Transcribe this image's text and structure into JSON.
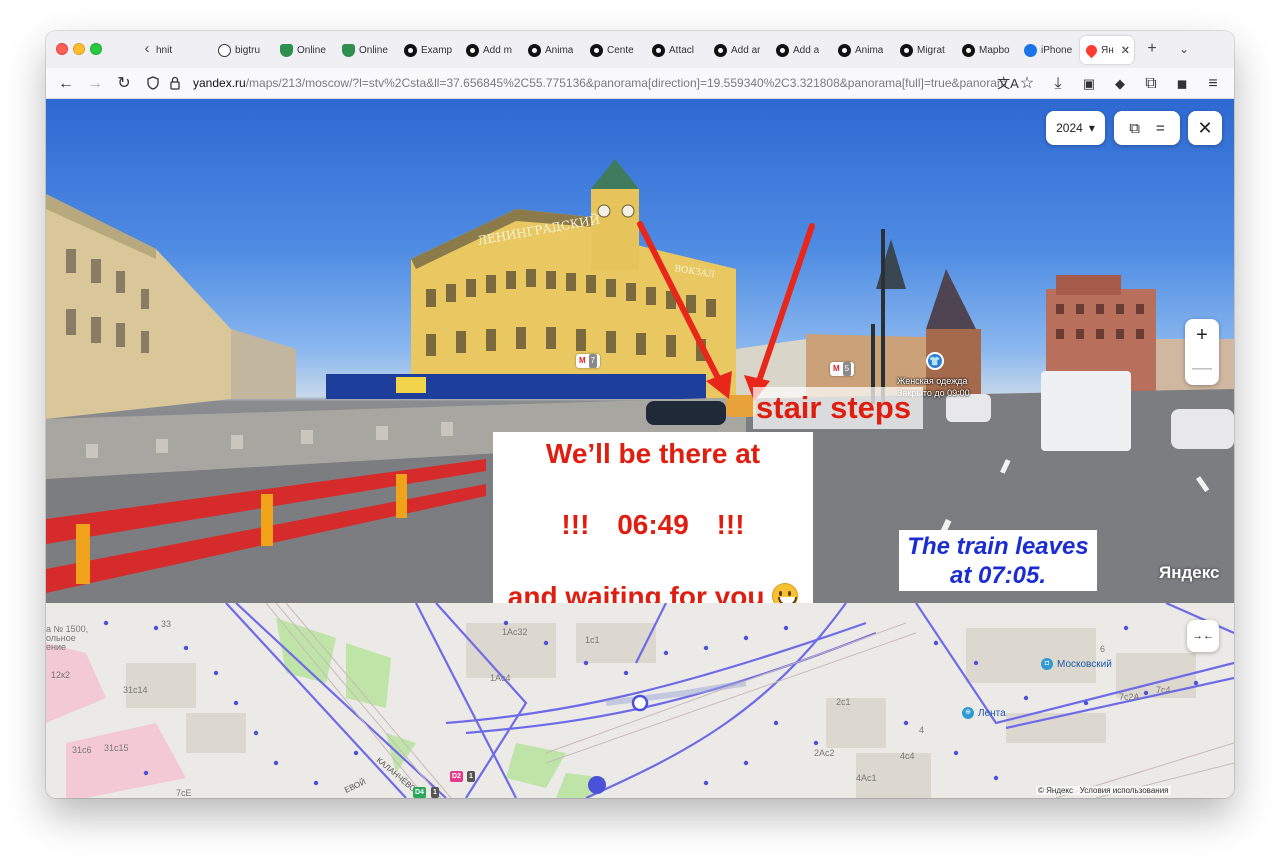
{
  "browser": {
    "tabs": [
      {
        "label": "hnit",
        "icon": "back-arrow-favicon"
      },
      {
        "label": "bigtru",
        "icon": "globe-favicon"
      },
      {
        "label": "Online",
        "icon": "shield-favicon"
      },
      {
        "label": "Online",
        "icon": "shield-favicon"
      },
      {
        "label": "Examp",
        "icon": "open-favicon"
      },
      {
        "label": "Add m",
        "icon": "open-favicon"
      },
      {
        "label": "Anima",
        "icon": "open-favicon"
      },
      {
        "label": "Cente",
        "icon": "open-favicon"
      },
      {
        "label": "Attacl",
        "icon": "open-favicon"
      },
      {
        "label": "Add ar",
        "icon": "open-favicon"
      },
      {
        "label": "Add a",
        "icon": "open-favicon"
      },
      {
        "label": "Anima",
        "icon": "open-favicon"
      },
      {
        "label": "Migrat",
        "icon": "open-favicon"
      },
      {
        "label": "Mapbo",
        "icon": "open-favicon"
      },
      {
        "label": "iPhone",
        "icon": "ip-favicon"
      }
    ],
    "active_tab": {
      "label": "Ян",
      "close": "✕"
    },
    "url_host": "yandex.ru",
    "url_path": "/maps/213/moscow/?l=stv%2Csta&ll=37.656845%2C55.775136&panorama[direction]=19.559340%2C3.321808&panorama[full]=true&panoram"
  },
  "panorama": {
    "year": "2024",
    "year_caret": "▾",
    "zoom_in": "+",
    "zoom_out": "—",
    "poi_name": "Женская одежда",
    "poi_hours": "Закрыто до 09:00",
    "metro_left": {
      "m": "M",
      "n": "7"
    },
    "metro_right": {
      "m": "M",
      "n": "5"
    },
    "watermark": "Яндекс",
    "station_sign_1": "ЛЕНИНГРАДСКИЙ",
    "station_sign_2": "ВОКЗАЛ"
  },
  "overlays": {
    "stair_label": "stair steps",
    "message_line1": "We’ll be there at",
    "message_line2_a": "!!!",
    "message_line2_time": "06:49",
    "message_line2_b": "!!!",
    "message_line3": "and waiting for you",
    "train_line1": "The train leaves",
    "train_line2": "at 07:05."
  },
  "map": {
    "labels": [
      "а № 1500,",
      "ольное",
      "ение",
      "33",
      "12к2",
      "31с14",
      "31с6",
      "31с15",
      "7сЕ",
      "1Ас32",
      "1с1",
      "1Ас4",
      "2с1",
      "2Ас2",
      "4с4",
      "4Ас1",
      "4",
      "6",
      "7с2А",
      "7с4",
      "КАЛАНЧЁВСК",
      "ЕВОЙ"
    ],
    "poi_moskovsky": "Московский",
    "poi_lenta": "Лента",
    "route_d2": "D2",
    "route_d4": "D4",
    "route_1": "1",
    "copyright": "© Яндекс",
    "terms": "Условия использования",
    "collapse_btn": "→←"
  }
}
